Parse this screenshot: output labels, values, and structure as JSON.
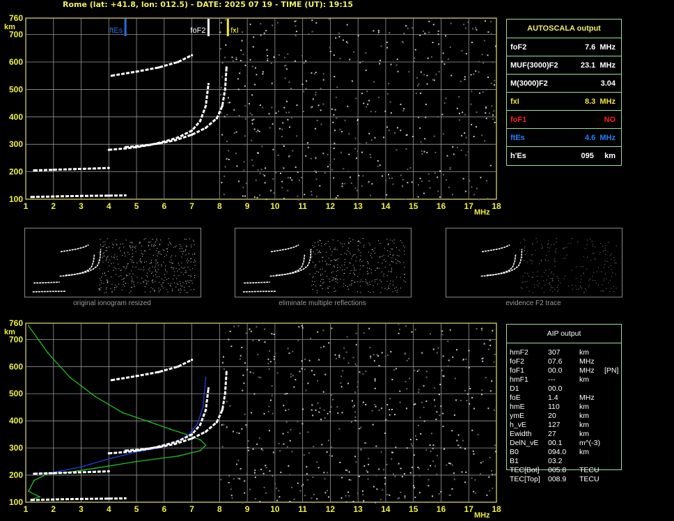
{
  "header": {
    "text": "Rome (lat: +41.8, lon: 012.5) - DATE: 2025 07 19 - TIME (UT): 19:15"
  },
  "chart_data": [
    {
      "type": "scatter",
      "title": "",
      "xlabel": "MHz",
      "ylabel": "km",
      "xlim": [
        1,
        18
      ],
      "ylim": [
        100,
        760
      ],
      "grid": true,
      "x_ticks": [
        "1",
        "2",
        "3",
        "4",
        "5",
        "6",
        "7",
        "8",
        "9",
        "10",
        "11",
        "12",
        "13",
        "14",
        "15",
        "16",
        "17",
        "18"
      ],
      "y_ticks": [
        "100",
        "200",
        "300",
        "400",
        "500",
        "600",
        "700",
        "760"
      ],
      "markers": [
        {
          "name": "ftEs",
          "x": 4.6,
          "color": "#1e6fdc"
        },
        {
          "name": "foF2",
          "x": 7.6,
          "color": "#ffffff"
        },
        {
          "name": "fxI",
          "x": 8.3,
          "color": "#f0f020"
        }
      ],
      "series": [
        {
          "name": "",
          "color": "#ffffff",
          "x": [
            1.2,
            2.0,
            3.0,
            4.0,
            4.6
          ],
          "y": [
            108,
            110,
            112,
            113,
            114
          ]
        },
        {
          "name": "",
          "color": "#ffffff",
          "x": [
            1.3,
            2.0,
            2.8,
            3.5,
            4.0
          ],
          "y": [
            205,
            207,
            210,
            212,
            214
          ]
        },
        {
          "name": "",
          "color": "#ffffff",
          "x": [
            4.0,
            4.6,
            5.0,
            5.5,
            6.0,
            6.5,
            7.0,
            7.3,
            7.5,
            7.6
          ],
          "y": [
            280,
            285,
            290,
            298,
            310,
            325,
            350,
            385,
            440,
            520
          ]
        },
        {
          "name": "",
          "color": "#ffffff",
          "x": [
            4.6,
            5.2,
            5.8,
            6.4,
            7.0,
            7.5,
            7.9,
            8.1,
            8.2,
            8.25
          ],
          "y": [
            290,
            295,
            303,
            315,
            335,
            360,
            395,
            440,
            500,
            580
          ]
        },
        {
          "name": "",
          "color": "#ffffff",
          "x": [
            4.1,
            5.0,
            5.8,
            6.5,
            7.0
          ],
          "y": [
            550,
            565,
            580,
            600,
            625
          ]
        }
      ]
    },
    {
      "type": "line",
      "title": "",
      "xlabel": "MHz",
      "ylabel": "km",
      "xlim": [
        1,
        18
      ],
      "ylim": [
        100,
        760
      ],
      "grid": true,
      "x_ticks": [
        "1",
        "2",
        "3",
        "4",
        "5",
        "6",
        "7",
        "8",
        "9",
        "10",
        "11",
        "12",
        "13",
        "14",
        "15",
        "16",
        "17",
        "18"
      ],
      "y_ticks": [
        "100",
        "200",
        "300",
        "400",
        "500",
        "600",
        "700",
        "760"
      ],
      "series": [
        {
          "name": "",
          "color": "#20c020",
          "x": [
            1.1,
            1.8,
            2.6,
            3.5,
            4.5,
            5.5,
            6.2,
            6.8,
            7.3,
            7.5,
            7.3,
            6.5,
            5.0,
            3.5,
            2.5,
            1.8,
            1.3,
            1.1,
            1.5,
            1.2
          ],
          "y": [
            750,
            650,
            560,
            490,
            430,
            395,
            370,
            350,
            330,
            310,
            290,
            270,
            250,
            225,
            210,
            205,
            180,
            140,
            120,
            110
          ]
        },
        {
          "name": "",
          "color": "#2040e0",
          "x": [
            1.3,
            2.0,
            3.0,
            4.0,
            5.0,
            5.8,
            6.4,
            6.9,
            7.2,
            7.4,
            7.5
          ],
          "y": [
            205,
            210,
            230,
            260,
            285,
            300,
            320,
            350,
            390,
            450,
            560
          ]
        },
        {
          "name": "",
          "color": "#ffffff",
          "x": [
            1.2,
            2.0,
            3.0,
            4.0,
            4.6
          ],
          "y": [
            108,
            110,
            112,
            113,
            114
          ]
        },
        {
          "name": "",
          "color": "#ffffff",
          "x": [
            1.3,
            2.0,
            2.8,
            3.5,
            4.0
          ],
          "y": [
            205,
            207,
            210,
            212,
            214
          ]
        },
        {
          "name": "",
          "color": "#ffffff",
          "x": [
            4.0,
            4.6,
            5.0,
            5.5,
            6.0,
            6.5,
            7.0,
            7.3,
            7.5,
            7.6
          ],
          "y": [
            280,
            285,
            290,
            298,
            310,
            325,
            350,
            385,
            440,
            520
          ]
        },
        {
          "name": "",
          "color": "#ffffff",
          "x": [
            4.6,
            5.2,
            5.8,
            6.4,
            7.0,
            7.5,
            7.9,
            8.1,
            8.2,
            8.25
          ],
          "y": [
            290,
            295,
            303,
            315,
            335,
            360,
            395,
            440,
            500,
            580
          ]
        },
        {
          "name": "",
          "color": "#ffffff",
          "x": [
            4.1,
            5.0,
            5.8,
            6.5,
            7.0
          ],
          "y": [
            550,
            565,
            580,
            600,
            625
          ]
        }
      ]
    }
  ],
  "autoscala": {
    "title": "AUTOSCALA output",
    "rows": [
      {
        "label": "foF2",
        "value": "7.6  MHz",
        "color": "#ffffff"
      },
      {
        "label": "MUF(3000)F2",
        "value": "23.1  MHz",
        "color": "#ffffff"
      },
      {
        "label": "M(3000)F2",
        "value": "3.04",
        "color": "#ffffff"
      },
      {
        "label": "fxI",
        "value": "8.3  MHz",
        "color": "#f0e040"
      },
      {
        "label": "foF1",
        "value": "NO",
        "color": "#ff2020"
      },
      {
        "label": "ftEs",
        "value": "4.6  MHz",
        "color": "#2080ff"
      },
      {
        "label": "h'Es",
        "value": "095     km",
        "color": "#ffffff"
      }
    ]
  },
  "thumbnails": [
    {
      "caption": "original ionogram resized"
    },
    {
      "caption": "eliminate multiple reflections"
    },
    {
      "caption": "evidence F2 trace"
    }
  ],
  "aip": {
    "title": "AIP output",
    "rows": [
      {
        "name": "hmF2",
        "value": "307",
        "unit": "km",
        "note": ""
      },
      {
        "name": "foF2",
        "value": "07.6",
        "unit": "MHz",
        "note": ""
      },
      {
        "name": "foF1",
        "value": "00.0",
        "unit": "MHz",
        "note": "[PN]"
      },
      {
        "name": "hmF1",
        "value": "---",
        "unit": "km",
        "note": ""
      },
      {
        "name": "D1",
        "value": "00.0",
        "unit": "",
        "note": ""
      },
      {
        "name": "foE",
        "value": "1.4",
        "unit": "MHz",
        "note": ""
      },
      {
        "name": "hmE",
        "value": "110",
        "unit": "km",
        "note": ""
      },
      {
        "name": "ymE",
        "value": "20",
        "unit": "km",
        "note": ""
      },
      {
        "name": "h_vE",
        "value": "127",
        "unit": "km",
        "note": ""
      },
      {
        "name": "Ewidth",
        "value": "27",
        "unit": "km",
        "note": ""
      },
      {
        "name": "DelN_vE",
        "value": "00.1",
        "unit": "m^(-3)",
        "note": ""
      },
      {
        "name": "B0",
        "value": "094.0",
        "unit": "km",
        "note": ""
      },
      {
        "name": "B1",
        "value": "03.2",
        "unit": "",
        "note": ""
      },
      {
        "name": "TEC[Bot]",
        "value": "005.8",
        "unit": "TECU",
        "note": ""
      },
      {
        "name": "TEC[Top]",
        "value": "008.9",
        "unit": "TECU",
        "note": ""
      }
    ]
  }
}
